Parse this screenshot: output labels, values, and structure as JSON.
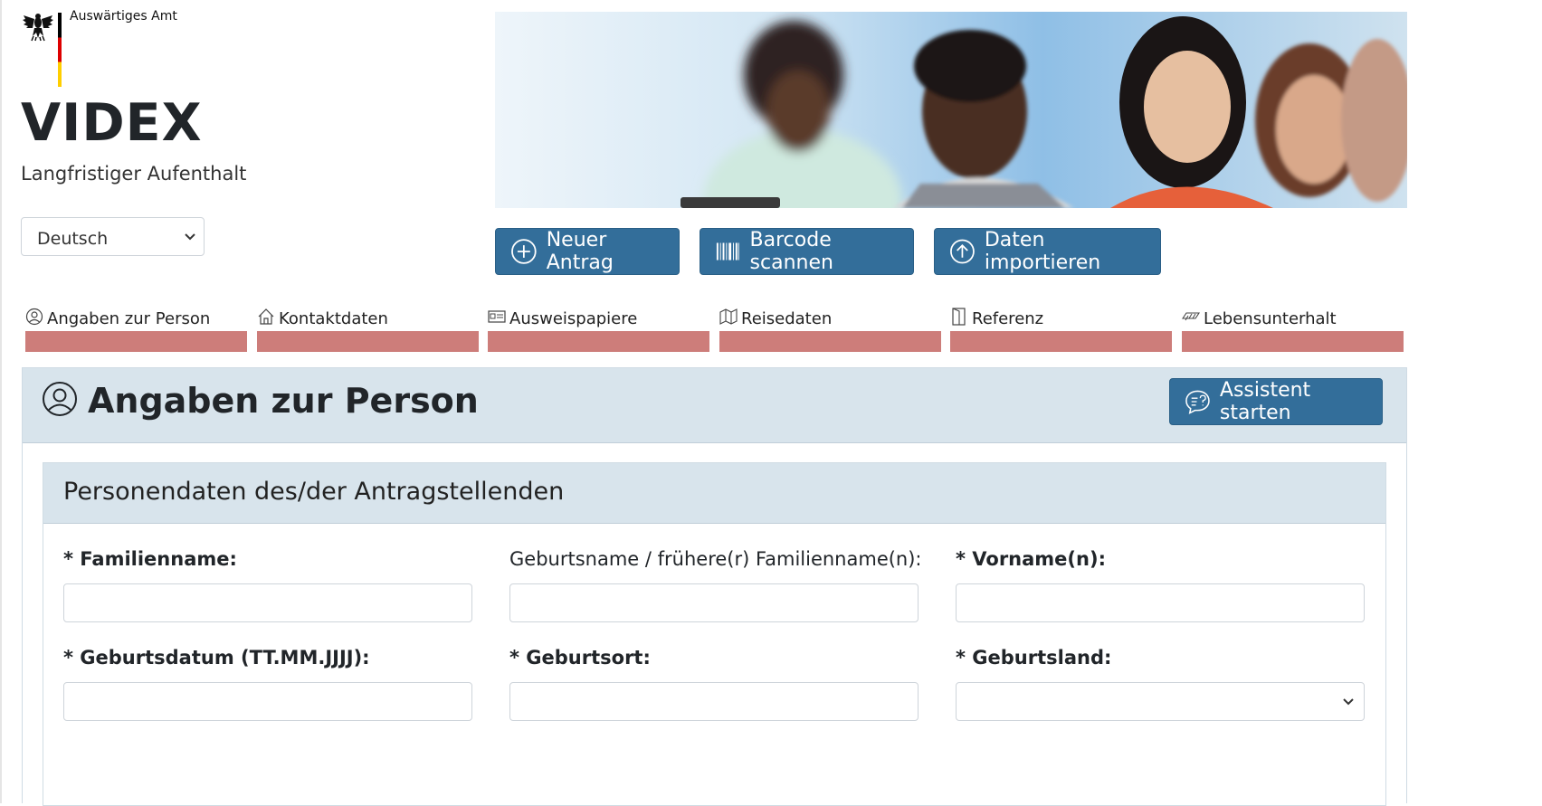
{
  "header": {
    "ministry": "Auswärtiges Amt",
    "app_title": "VIDEX",
    "app_subtitle": "Langfristiger Aufenthalt"
  },
  "language_select": {
    "value": "Deutsch"
  },
  "actions": {
    "new_application": "Neuer Antrag",
    "scan_barcode": "Barcode scannen",
    "import_data": "Daten importieren"
  },
  "steps": [
    {
      "label": "Angaben zur Person",
      "icon": "person-circle-icon"
    },
    {
      "label": "Kontaktdaten",
      "icon": "house-icon"
    },
    {
      "label": "Ausweispapiere",
      "icon": "id-card-icon"
    },
    {
      "label": "Reisedaten",
      "icon": "map-icon"
    },
    {
      "label": "Referenz",
      "icon": "door-icon"
    },
    {
      "label": "Lebensunterhalt",
      "icon": "money-icon"
    }
  ],
  "colors": {
    "primary": "#336e9a",
    "step_incomplete": "#cd7d7a",
    "panel_header": "#d8e4ec"
  },
  "page": {
    "title": "Angaben zur Person",
    "assistant_button": "Assistent starten"
  },
  "section": {
    "title": "Personendaten des/der Antragstellenden",
    "fields": {
      "family_name": "* Familienname:",
      "birth_name": "Geburtsname / frühere(r) Familienname(n):",
      "first_names": "* Vorname(n):",
      "birth_date": "* Geburtsdatum (TT.MM.JJJJ):",
      "birth_place": "* Geburtsort:",
      "birth_country": "* Geburtsland:"
    }
  }
}
